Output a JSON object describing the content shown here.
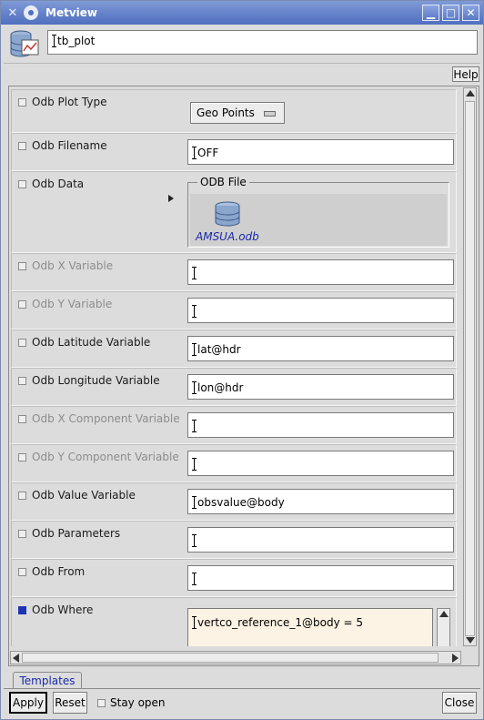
{
  "window": {
    "title": "Metview",
    "controls": [
      "minimize",
      "maximize",
      "close"
    ]
  },
  "header": {
    "icon": "database-plot-icon",
    "name_value": "tb_plot"
  },
  "help_label": "Help",
  "params": [
    {
      "label": "Odb Plot Type",
      "enabled": true,
      "checked": false,
      "kind": "dropdown",
      "value": "Geo Points"
    },
    {
      "label": "Odb Filename",
      "enabled": true,
      "checked": false,
      "kind": "text",
      "value": "OFF"
    },
    {
      "label": "Odb Data",
      "enabled": true,
      "checked": false,
      "kind": "odb",
      "group_label": "ODB File",
      "file_name": "AMSUA.odb"
    },
    {
      "label": "Odb X Variable",
      "enabled": false,
      "checked": false,
      "kind": "text",
      "value": ""
    },
    {
      "label": "Odb Y Variable",
      "enabled": false,
      "checked": false,
      "kind": "text",
      "value": ""
    },
    {
      "label": "Odb Latitude Variable",
      "enabled": true,
      "checked": false,
      "kind": "text",
      "value": "lat@hdr"
    },
    {
      "label": "Odb Longitude Variable",
      "enabled": true,
      "checked": false,
      "kind": "text",
      "value": "lon@hdr"
    },
    {
      "label": "Odb X Component Variable",
      "enabled": false,
      "checked": false,
      "kind": "text",
      "value": ""
    },
    {
      "label": "Odb Y Component Variable",
      "enabled": false,
      "checked": false,
      "kind": "text",
      "value": ""
    },
    {
      "label": "Odb Value Variable",
      "enabled": true,
      "checked": false,
      "kind": "text",
      "value": "obsvalue@body"
    },
    {
      "label": "Odb Parameters",
      "enabled": true,
      "checked": false,
      "kind": "text",
      "value": ""
    },
    {
      "label": "Odb From",
      "enabled": true,
      "checked": false,
      "kind": "text",
      "value": ""
    },
    {
      "label": "Odb Where",
      "enabled": true,
      "checked": true,
      "kind": "textarea",
      "value": "vertco_reference_1@body = 5"
    }
  ],
  "tabs": [
    {
      "label": "Templates"
    }
  ],
  "footer": {
    "apply_label": "Apply",
    "reset_label": "Reset",
    "stay_open_label": "Stay open",
    "stay_open_checked": false,
    "close_label": "Close"
  }
}
